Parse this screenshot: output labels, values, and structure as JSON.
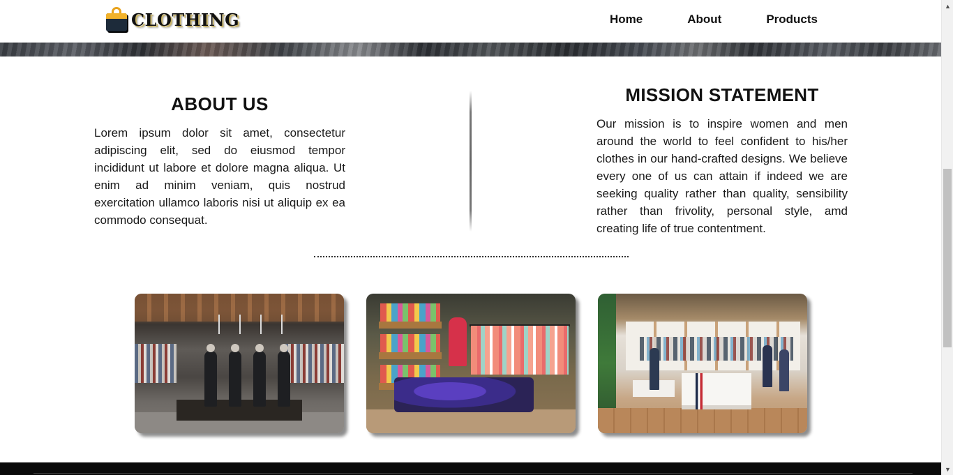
{
  "brand": {
    "logo_text": "CLOTHING",
    "logo_icon": "shopping-bag-icon"
  },
  "nav": {
    "items": [
      {
        "label": "Home"
      },
      {
        "label": "About"
      },
      {
        "label": "Products"
      }
    ]
  },
  "about": {
    "heading": "ABOUT US",
    "body": "Lorem ipsum dolor sit amet, consectetur adipiscing elit, sed do eiusmod tempor incididunt ut labore et dolore magna aliqua. Ut enim ad minim veniam, quis nostrud exercitation ullamco laboris nisi ut aliquip ex ea commodo consequat."
  },
  "mission": {
    "heading": "MISSION STATEMENT",
    "body": "Our mission is to inspire women and men around the world to feel confident to his/her clothes in our hand-crafted designs. We believe every one of us can attain if indeed we are seeking quality rather than quality, sensibility rather than frivolity, personal style, amd creating life of true contentment."
  },
  "colors": {
    "text": "#111111",
    "background": "#ffffff",
    "footer": "#0a0a0a"
  }
}
